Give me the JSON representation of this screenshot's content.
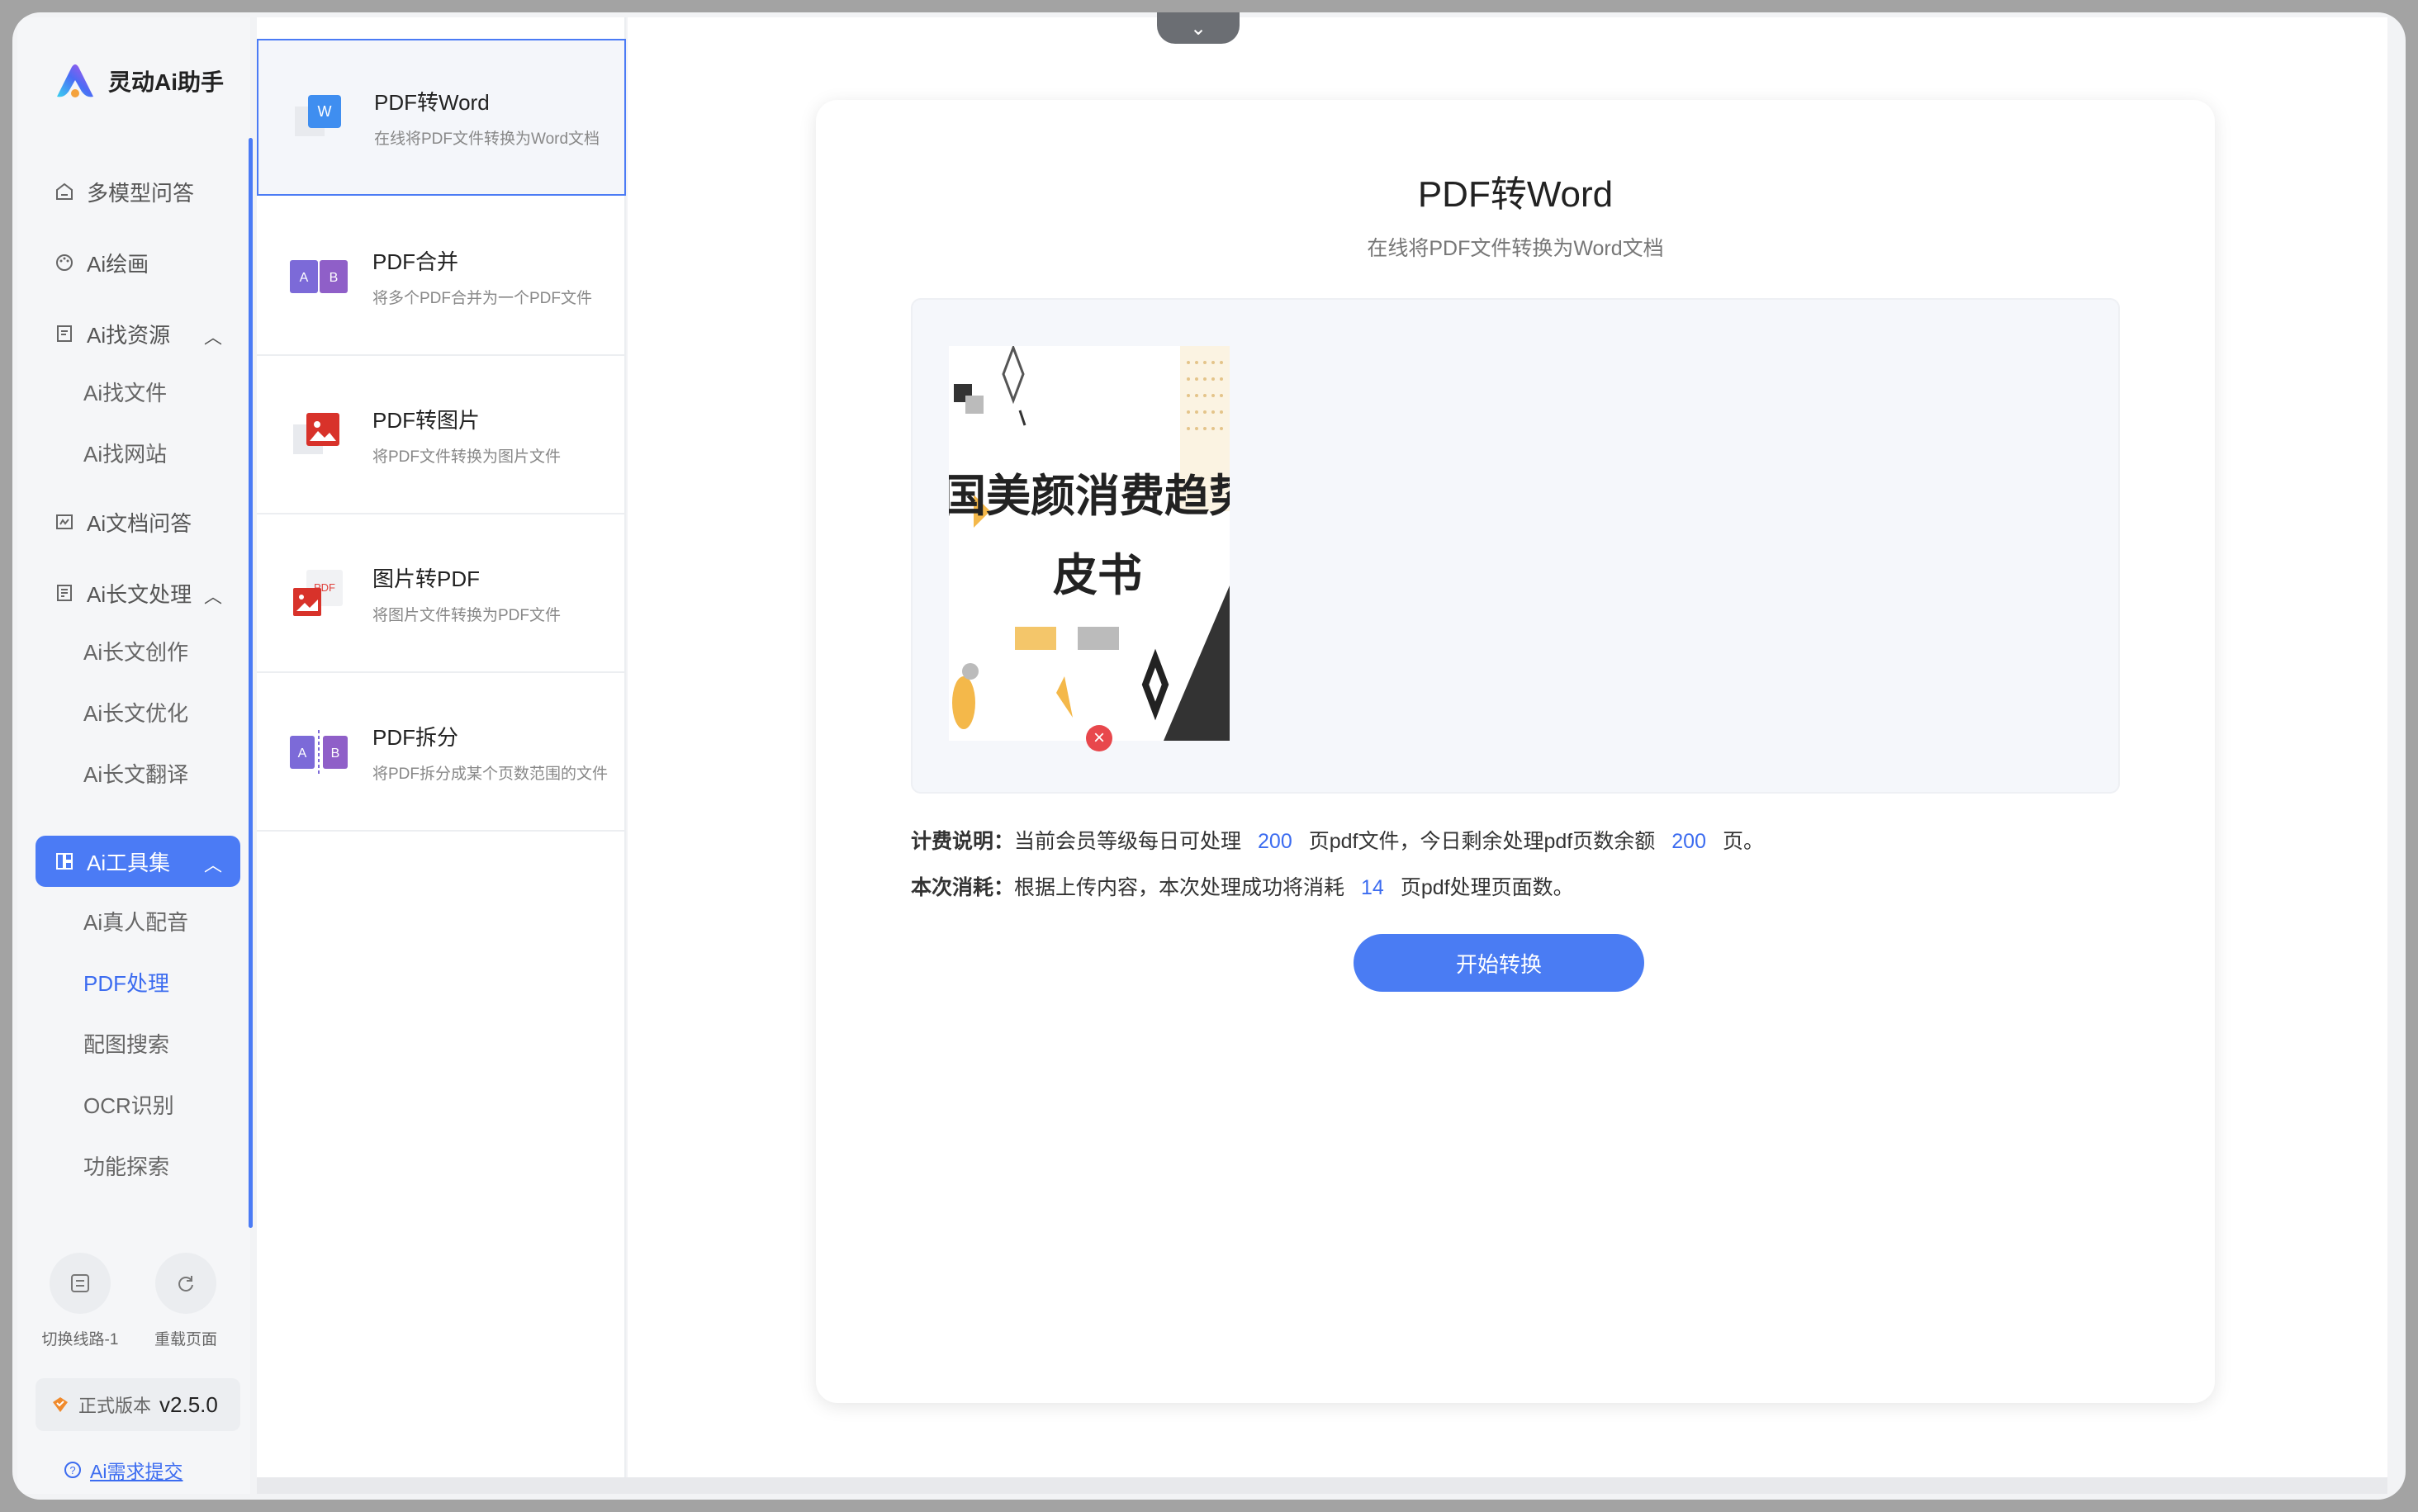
{
  "app": {
    "name": "灵动Ai助手"
  },
  "sidebar": {
    "items": [
      {
        "label": "多模型问答",
        "icon": "home-icon"
      },
      {
        "label": "Ai绘画",
        "icon": "palette-icon"
      },
      {
        "label": "Ai找资源",
        "icon": "document-icon",
        "expanded": true,
        "children": [
          "Ai找文件",
          "Ai找网站"
        ]
      },
      {
        "label": "Ai文档问答",
        "icon": "image-doc-icon"
      },
      {
        "label": "Ai长文处理",
        "icon": "longtext-icon",
        "expanded": true,
        "children": [
          "Ai长文创作",
          "Ai长文优化",
          "Ai长文翻译"
        ]
      },
      {
        "label": "Ai工具集",
        "icon": "grid-icon",
        "expanded": true,
        "active": true,
        "children": [
          "Ai真人配音",
          "PDF处理",
          "配图搜索",
          "OCR识别",
          "功能探索"
        ]
      }
    ],
    "active_child": "PDF处理",
    "tools": [
      {
        "label": "切换线路-1",
        "icon": "switch-line-icon"
      },
      {
        "label": "重载页面",
        "icon": "reload-icon"
      }
    ],
    "version": {
      "label": "正式版本",
      "value": "v2.5.0"
    },
    "feedback": "Ai需求提交"
  },
  "tools_list": [
    {
      "title": "PDF转Word",
      "desc": "在线将PDF文件转换为Word文档",
      "icon": "word-icon",
      "active": true
    },
    {
      "title": "PDF合并",
      "desc": "将多个PDF合并为一个PDF文件",
      "icon": "merge-icon"
    },
    {
      "title": "PDF转图片",
      "desc": "将PDF文件转换为图片文件",
      "icon": "pdf-image-icon"
    },
    {
      "title": "图片转PDF",
      "desc": "将图片文件转换为PDF文件",
      "icon": "image-pdf-icon"
    },
    {
      "title": "PDF拆分",
      "desc": "将PDF拆分成某个页数范围的文件",
      "icon": "split-icon"
    }
  ],
  "main": {
    "title": "PDF转Word",
    "subtitle": "在线将PDF文件转换为Word文档",
    "thumbnail": {
      "title_line1": "中国美颜消费趋势白",
      "title_line2": "皮书"
    },
    "billing": {
      "label": "计费说明：",
      "text_a": "当前会员等级每日可处理",
      "daily_limit": "200",
      "text_b": "页pdf文件，今日剩余处理pdf页数余额",
      "remaining": "200",
      "text_c": "页。"
    },
    "consumption": {
      "label": "本次消耗：",
      "text_a": "根据上传内容，本次处理成功将消耗",
      "pages": "14",
      "text_b": "页pdf处理页面数。"
    },
    "start_button": "开始转换"
  },
  "colors": {
    "accent": "#4b7bf5",
    "link": "#3c6cf0",
    "danger": "#e8474c"
  }
}
